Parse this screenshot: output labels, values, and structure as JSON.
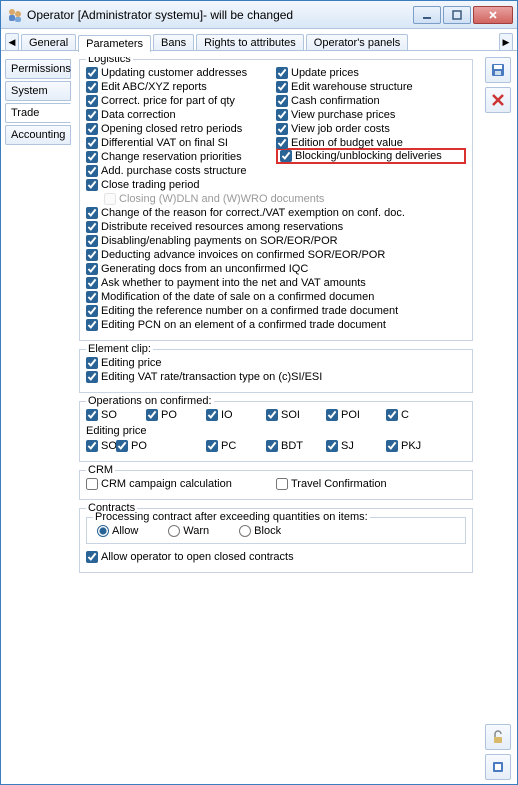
{
  "title": "Operator [Administrator systemu]- will be changed",
  "tabs": [
    "General",
    "Parameters",
    "Bans",
    "Rights to attributes",
    "Operator's panels"
  ],
  "active_tab": 1,
  "side_tabs": [
    "Permissions",
    "System",
    "Trade",
    "Accounting"
  ],
  "active_side_tab": 2,
  "logistics": {
    "legend": "Logistics",
    "left": [
      {
        "label": "Updating customer addresses",
        "checked": true
      },
      {
        "label": "Edit ABC/XYZ reports",
        "checked": true
      },
      {
        "label": "Correct. price for part of qty",
        "checked": true
      },
      {
        "label": "Data correction",
        "checked": true
      },
      {
        "label": "Opening closed retro periods",
        "checked": true
      },
      {
        "label": "Differential VAT on final SI",
        "checked": true
      },
      {
        "label": "Change reservation priorities",
        "checked": true
      },
      {
        "label": "Add. purchase costs structure",
        "checked": true
      },
      {
        "label": "Close trading period",
        "checked": true
      }
    ],
    "right": [
      {
        "label": "Update prices",
        "checked": true
      },
      {
        "label": "Edit warehouse structure",
        "checked": true
      },
      {
        "label": "Cash confirmation",
        "checked": true
      },
      {
        "label": "View purchase prices",
        "checked": true
      },
      {
        "label": "View job order costs",
        "checked": true
      },
      {
        "label": "Edition of budget value",
        "checked": true
      },
      {
        "label": "Blocking/unblocking deliveries",
        "checked": true,
        "highlight": true
      }
    ],
    "closing_disabled": {
      "label": "Closing (W)DLN and (W)WRO documents",
      "checked": false
    },
    "full": [
      {
        "label": "Change of the reason for correct./VAT exemption on conf. doc.",
        "checked": true
      },
      {
        "label": "Distribute received resources among reservations",
        "checked": true
      },
      {
        "label": "Disabling/enabling payments on SOR/EOR/POR",
        "checked": true
      },
      {
        "label": "Deducting advance invoices on confirmed SOR/EOR/POR",
        "checked": true
      },
      {
        "label": "Generating docs from an unconfirmed IQC",
        "checked": true
      },
      {
        "label": "Ask whether to payment into the net and VAT amounts",
        "checked": true
      },
      {
        "label": "Modification of the date of sale on a confirmed documen",
        "checked": true
      },
      {
        "label": "Editing the reference number on a confirmed trade document",
        "checked": true
      },
      {
        "label": "Editing PCN on an element of a confirmed trade document",
        "checked": true
      }
    ]
  },
  "element_clip": {
    "legend": "Element clip:",
    "items": [
      {
        "label": "Editing price",
        "checked": true
      },
      {
        "label": "Editing VAT rate/transaction type on (c)SI/ESI",
        "checked": true
      }
    ]
  },
  "operations": {
    "legend": "Operations on confirmed:",
    "row1": [
      {
        "label": "SO",
        "checked": true
      },
      {
        "label": "PO",
        "checked": true
      },
      {
        "label": "IO",
        "checked": true
      },
      {
        "label": "SOI",
        "checked": true
      },
      {
        "label": "POI",
        "checked": true
      },
      {
        "label": "C",
        "checked": true
      }
    ],
    "editing_price_label": "Editing price",
    "row2": [
      {
        "label": "SO",
        "checked": true
      },
      {
        "label": "PO",
        "checked": true
      },
      {
        "label": "PC",
        "checked": true
      },
      {
        "label": "BDT",
        "checked": true
      },
      {
        "label": "SJ",
        "checked": true
      },
      {
        "label": "PKJ",
        "checked": true
      }
    ]
  },
  "crm": {
    "legend": "CRM",
    "items": [
      {
        "label": "CRM campaign calculation",
        "checked": false
      },
      {
        "label": "Travel Confirmation",
        "checked": false
      }
    ]
  },
  "contracts": {
    "legend": "Contracts",
    "sub_legend": "Processing contract after exceeding quantities on items:",
    "radios": [
      {
        "label": "Allow",
        "checked": true
      },
      {
        "label": "Warn",
        "checked": false
      },
      {
        "label": "Block",
        "checked": false
      }
    ],
    "allow_open": {
      "label": "Allow operator to open closed contracts",
      "checked": true
    }
  }
}
